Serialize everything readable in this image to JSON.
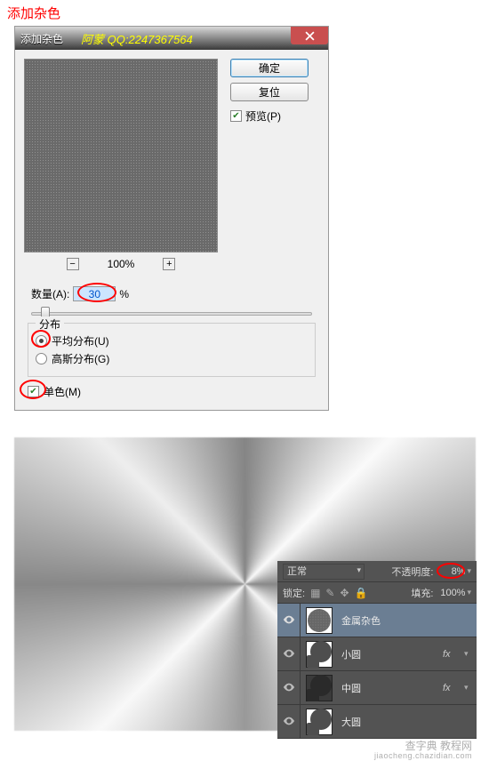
{
  "annotation": {
    "title": "添加杂色"
  },
  "dialog": {
    "title": "添加杂色",
    "watermark": "阿蒙 QQ:2247367564",
    "buttons": {
      "ok": "确定",
      "reset": "复位"
    },
    "preview_label": "预览(P)",
    "zoom_pct": "100%",
    "amount": {
      "label": "数量(A):",
      "value": "30",
      "unit": "%"
    },
    "distribution": {
      "group_label": "分布",
      "uniform": "平均分布(U)",
      "gaussian": "高斯分布(G)"
    },
    "monochrome": "单色(M)"
  },
  "layers": {
    "blend_mode": "正常",
    "opacity_label": "不透明度:",
    "opacity_value": "8%",
    "lock_label": "锁定:",
    "fill_label": "填充:",
    "fill_value": "100%",
    "rows": [
      {
        "name": "金属杂色",
        "fx": ""
      },
      {
        "name": "小圆",
        "fx": "fx"
      },
      {
        "name": "中圆",
        "fx": "fx"
      },
      {
        "name": "大圆",
        "fx": ""
      }
    ]
  },
  "site": {
    "main": "查字典 教程网",
    "sub": "jiaocheng.chazidian.com"
  }
}
